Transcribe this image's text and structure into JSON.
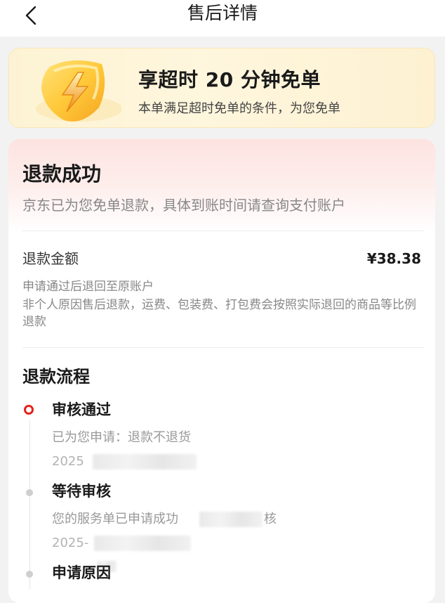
{
  "header": {
    "title": "售后详情",
    "back_icon": "chevron-left-icon"
  },
  "promo": {
    "title": "享超时 20 分钟免单",
    "subtitle": "本单满足超时免单的条件，为您免单",
    "badge_icon": "lightning-shield-icon"
  },
  "status": {
    "title": "退款成功",
    "description": "京东已为您免单退款，具体到账时间请查询支付账户"
  },
  "refund": {
    "label": "退款金额",
    "amount": "¥38.38",
    "note_line1": "申请通过后退回至原账户",
    "note_line2": "非个人原因售后退款，运费、包装费、打包费会按照实际退回的商品等比例退款"
  },
  "flow": {
    "title": "退款流程",
    "steps": [
      {
        "title": "审核通过",
        "desc": "已为您申请：退款不退货",
        "time": "2025"
      },
      {
        "title": "等待审核",
        "desc": "您的服务单已申请成功",
        "desc_tail": "核",
        "time": "2025-"
      },
      {
        "title": "申请原因"
      }
    ]
  },
  "colors": {
    "accent_red": "#e2231a",
    "promo_bg": "#fdf3d4",
    "page_bg": "#f2f2f2"
  }
}
